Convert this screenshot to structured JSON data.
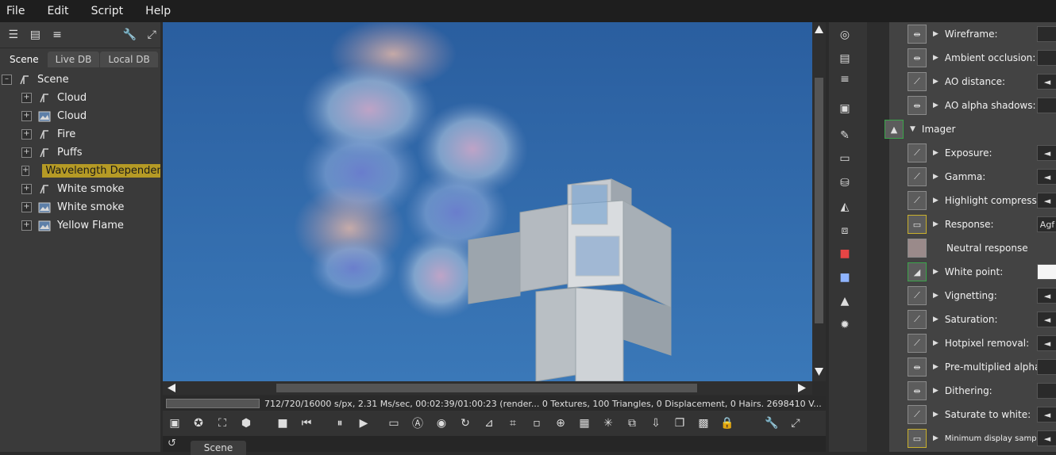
{
  "menu": [
    "File",
    "Edit",
    "Script",
    "Help"
  ],
  "tabs": [
    "Scene",
    "Live DB",
    "Local DB"
  ],
  "tree": {
    "root": "Scene",
    "items": [
      {
        "label": "Cloud",
        "icon": "geometry-node-icon"
      },
      {
        "label": "Cloud",
        "icon": "image-node-icon"
      },
      {
        "label": "Fire",
        "icon": "geometry-node-icon"
      },
      {
        "label": "Puffs",
        "icon": "geometry-node-icon"
      },
      {
        "label": "Wavelength Dependen",
        "icon": "image-node-icon",
        "selected": true
      },
      {
        "label": "White smoke",
        "icon": "geometry-node-icon"
      },
      {
        "label": "White smoke",
        "icon": "image-node-icon"
      },
      {
        "label": "Yellow Flame",
        "icon": "image-node-icon"
      }
    ]
  },
  "status": {
    "text": "712/720/16000 s/px, 2.31 Ms/sec, 00:02:39/01:00:23 (render... 0 Textures, 100 Triangles, 0 Displacement, 0 Hairs. 2698410 V..."
  },
  "bottom_tab": "Scene",
  "properties": [
    {
      "label": "Wireframe:",
      "value": ""
    },
    {
      "label": "Ambient occlusion:",
      "value": ""
    },
    {
      "label": "AO distance:",
      "value": "◄"
    },
    {
      "label": "AO alpha shadows:",
      "value": ""
    },
    {
      "label": "Imager",
      "section": true
    },
    {
      "label": "Exposure:",
      "value": "◄"
    },
    {
      "label": "Gamma:",
      "value": "◄"
    },
    {
      "label": "Highlight compression:",
      "value": "◄"
    },
    {
      "label": "Response:",
      "value": "Agf"
    },
    {
      "label": "Neutral response",
      "value": ""
    },
    {
      "label": "White point:",
      "value": ""
    },
    {
      "label": "Vignetting:",
      "value": "◄"
    },
    {
      "label": "Saturation:",
      "value": "◄"
    },
    {
      "label": "Hotpixel removal:",
      "value": "◄"
    },
    {
      "label": "Pre-multiplied alpha:",
      "value": ""
    },
    {
      "label": "Dithering:",
      "value": ""
    },
    {
      "label": "Saturate to white:",
      "value": "◄"
    },
    {
      "label": "Minimum display samples:",
      "value": "◄"
    }
  ],
  "colors": {
    "selected": "#b59a25",
    "sky": "#2d65a6"
  }
}
